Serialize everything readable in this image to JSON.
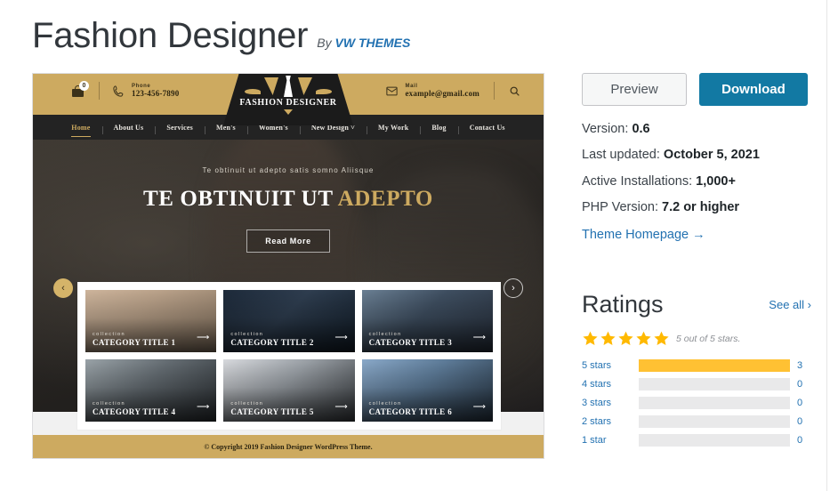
{
  "header": {
    "title": "Fashion Designer",
    "by_prefix": "By",
    "author": "VW THEMES"
  },
  "actions": {
    "preview_label": "Preview",
    "download_label": "Download"
  },
  "meta": [
    {
      "label": "Version:",
      "value": "0.6"
    },
    {
      "label": "Last updated:",
      "value": "October 5, 2021"
    },
    {
      "label": "Active Installations:",
      "value": "1,000+"
    },
    {
      "label": "PHP Version:",
      "value": "7.2 or higher"
    }
  ],
  "homepage_link": "Theme Homepage →",
  "ratings": {
    "title": "Ratings",
    "see_all": "See all ›",
    "summary": "5 out of 5 stars.",
    "star_count": 5,
    "rows": [
      {
        "label": "5 stars",
        "count": "3",
        "percent": 100
      },
      {
        "label": "4 stars",
        "count": "0",
        "percent": 0
      },
      {
        "label": "3 stars",
        "count": "0",
        "percent": 0
      },
      {
        "label": "2 stars",
        "count": "0",
        "percent": 0
      },
      {
        "label": "1 star",
        "count": "0",
        "percent": 0
      }
    ]
  },
  "preview": {
    "topbar": {
      "cart_badge": "0",
      "phone_label": "Phone",
      "phone_value": "123-456-7890",
      "mail_label": "Mail",
      "mail_value": "example@gmail.com"
    },
    "logo_text": "FASHION DESIGNER",
    "nav": [
      "Home",
      "About Us",
      "Services",
      "Men's",
      "Women's",
      "New Design ˅",
      "My Work",
      "Blog",
      "Contact Us"
    ],
    "hero": {
      "subtitle": "Te obtinuit ut adepto satis somno Aliisque",
      "title_plain": "TE OBTINUIT UT ",
      "title_gold": "ADEPTO",
      "button": "Read More",
      "prev": "‹",
      "next": "›"
    },
    "categories": [
      {
        "kicker": "collection",
        "title": "CATEGORY TITLE 1"
      },
      {
        "kicker": "collection",
        "title": "CATEGORY TITLE 2"
      },
      {
        "kicker": "collection",
        "title": "CATEGORY TITLE 3"
      },
      {
        "kicker": "collection",
        "title": "CATEGORY TITLE 4"
      },
      {
        "kicker": "collection",
        "title": "CATEGORY TITLE 5"
      },
      {
        "kicker": "collection",
        "title": "CATEGORY TITLE 6"
      }
    ],
    "footer": "© Copyright 2019 Fashion Designer WordPress Theme."
  },
  "colors": {
    "accent_blue": "#2271b1",
    "download_blue": "#1279a3",
    "star_gold": "#ffb900",
    "theme_gold": "#cdaa60"
  }
}
